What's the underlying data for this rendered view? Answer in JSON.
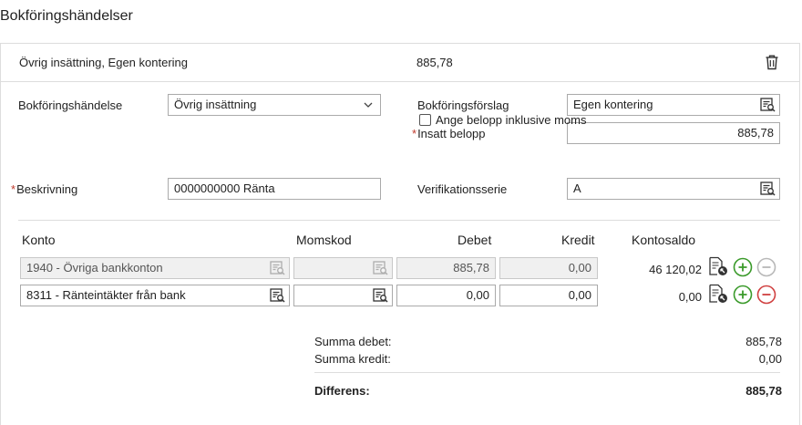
{
  "page_title": "Bokföringshändelser",
  "header": {
    "description": "Övrig insättning, Egen kontering",
    "amount": "885,78",
    "delete_icon": "trash-icon"
  },
  "form": {
    "event_label": "Bokföringshändelse",
    "event_value": "Övrig insättning",
    "proposal_label": "Bokföringsförslag",
    "proposal_value": "Egen kontering",
    "amount_required": "*",
    "amount_label": "Insatt belopp",
    "amount_value": "885,78",
    "incl_vat_label": "Ange belopp inklusive moms",
    "incl_vat_checked": false,
    "desc_required": "*",
    "desc_label": "Beskrivning",
    "desc_value": "0000000000  Ränta",
    "series_label": "Verifikationsserie",
    "series_value": "A"
  },
  "table": {
    "headers": {
      "account": "Konto",
      "vat": "Momskod",
      "debit": "Debet",
      "credit": "Kredit",
      "balance": "Kontosaldo"
    },
    "rows": [
      {
        "account": "1940 - Övriga bankkonton",
        "vat": "",
        "debit": "885,78",
        "credit": "0,00",
        "balance": "46 120,02",
        "disabled": true
      },
      {
        "account": "8311 - Ränteintäkter från bank",
        "vat": "",
        "debit": "0,00",
        "credit": "0,00",
        "balance": "0,00",
        "disabled": false
      }
    ]
  },
  "summary": {
    "debit_label": "Summa debet:",
    "debit_value": "885,78",
    "credit_label": "Summa kredit:",
    "credit_value": "0,00",
    "diff_label": "Differens:",
    "diff_value": "885,78"
  },
  "colors": {
    "required": "#c0392b",
    "add_green": "#3a9a2a",
    "remove_red": "#d04040",
    "disabled_gray": "#b8b8b8"
  }
}
